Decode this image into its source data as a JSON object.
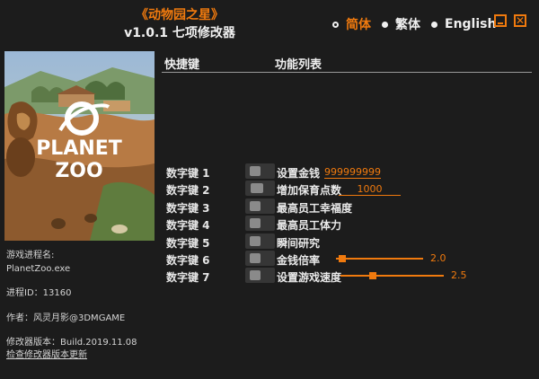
{
  "header": {
    "game_title": "《动物园之星》",
    "subtitle": "v1.0.1 七项修改器"
  },
  "languages": [
    {
      "label": "简体",
      "selected": true
    },
    {
      "label": "繁体",
      "selected": false
    },
    {
      "label": "English",
      "selected": false
    }
  ],
  "window_controls": {
    "minimize": "minimize-icon",
    "close": "close-icon",
    "close_glyph": "✕"
  },
  "colors": {
    "accent": "#f07a0e",
    "background": "#1c1c1c",
    "toggle": "#363636"
  },
  "cover": {
    "logo_line1": "PLANET",
    "logo_line2": "ZOO"
  },
  "info": {
    "process_label": "游戏进程名:",
    "process_name": "PlanetZoo.exe",
    "pid": "进程ID：13160",
    "author": "作者：风灵月影@3DMGAME",
    "version": "修改器版本：Build.2019.11.08",
    "update_link": "检查修改器版本更新"
  },
  "columns": {
    "hotkey": "快捷键",
    "features": "功能列表"
  },
  "cheats": [
    {
      "hotkey": "数字键 1",
      "name": "设置金钱",
      "value": "999999999",
      "enabled": false
    },
    {
      "hotkey": "数字键 2",
      "name": "增加保育点数",
      "value": "1000",
      "enabled": false
    },
    {
      "hotkey": "数字键 3",
      "name": "最高员工幸福度",
      "enabled": false
    },
    {
      "hotkey": "数字键 4",
      "name": "最高员工体力",
      "enabled": false
    },
    {
      "hotkey": "数字键 5",
      "name": "瞬间研究",
      "enabled": false
    },
    {
      "hotkey": "数字键 6",
      "name": "金钱倍率",
      "slider_value": "2.0",
      "slider_fraction": 0.07,
      "enabled": false
    },
    {
      "hotkey": "数字键 7",
      "name": "设置游戏速度",
      "slider_value": "2.5",
      "slider_fraction": 0.31,
      "enabled": false
    }
  ]
}
